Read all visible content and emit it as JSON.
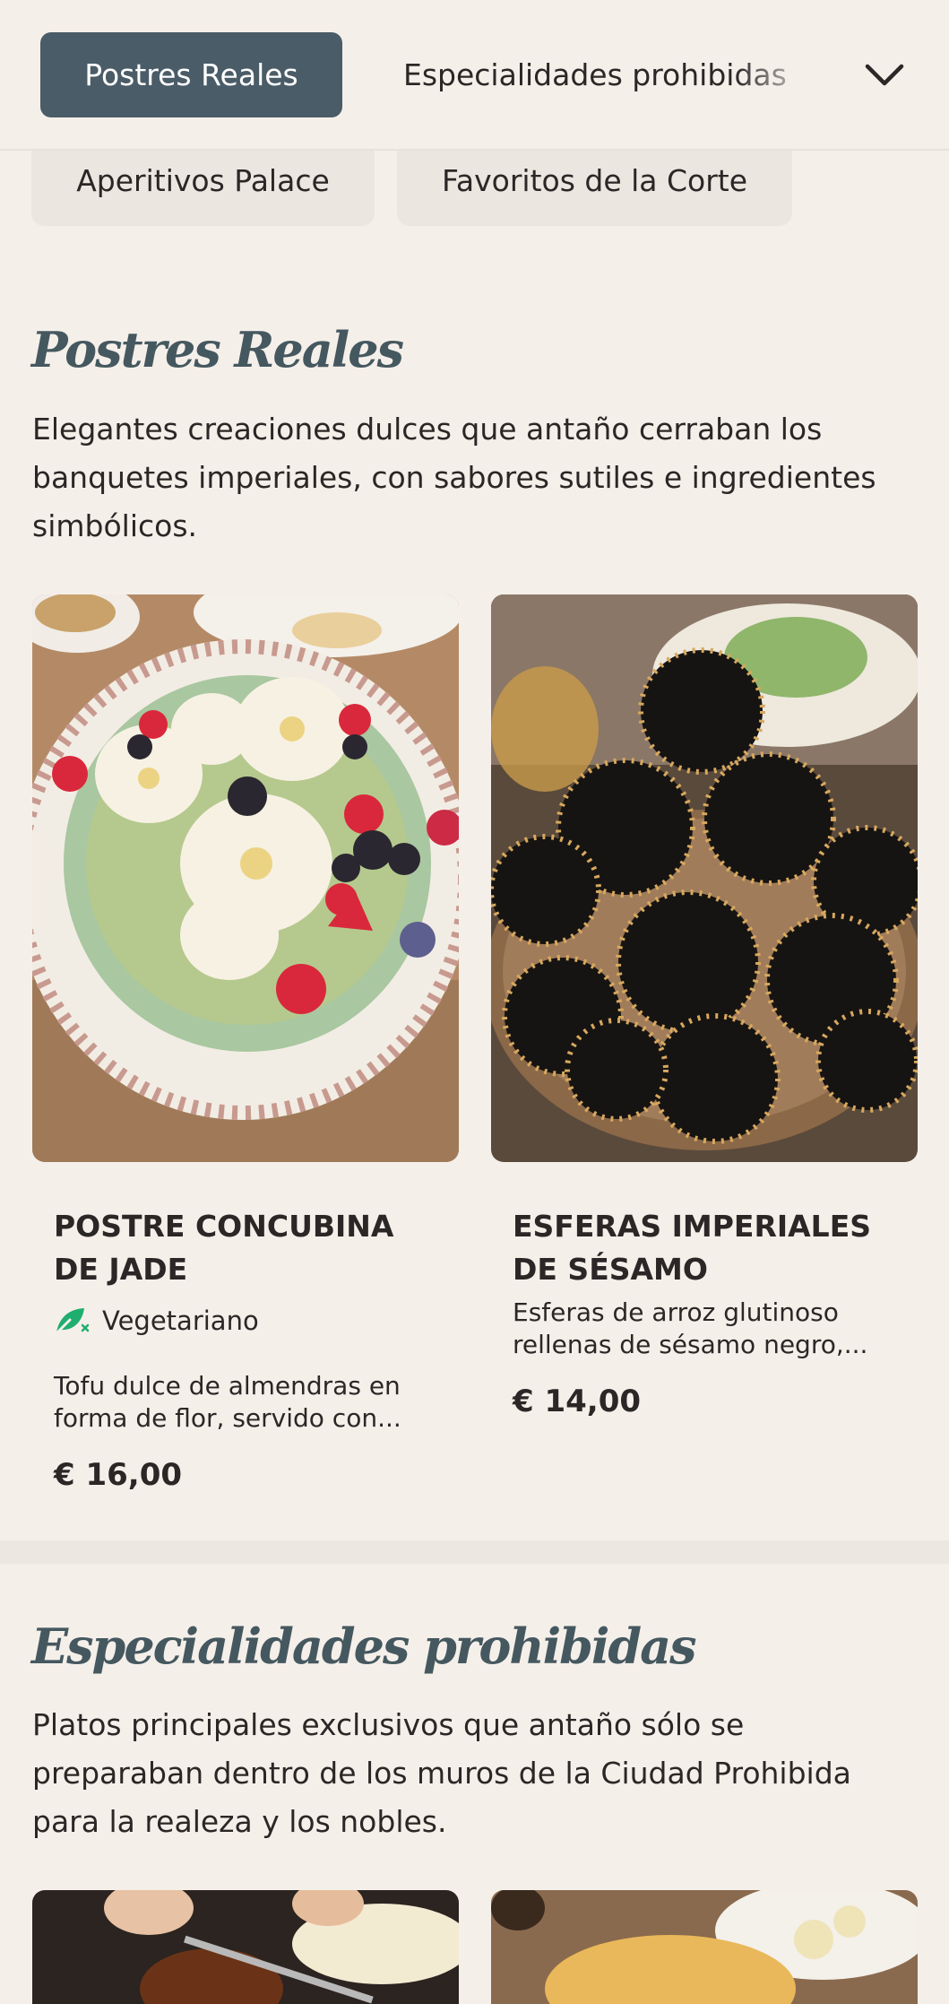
{
  "nav": {
    "tabs": [
      {
        "label": "Postres Reales",
        "active": true
      },
      {
        "label": "Especialidades prohibidas",
        "active": false
      },
      {
        "label": "Aperitivos Palace",
        "active": false
      },
      {
        "label": "Favoritos de la Corte",
        "active": false
      }
    ],
    "more_icon": "chevron-down-icon"
  },
  "sections": [
    {
      "title": "Postres Reales",
      "description": "Elegantes creaciones dulces que antaño cerraban los banquetes imperiales, con sabores sutiles e ingredientes simbólicos.",
      "items": [
        {
          "name": "POSTRE CONCUBINA DE JADE",
          "tag": "Vegetariano",
          "tag_icon": "vegetarian-leaf-icon",
          "description": "Tofu dulce de almendras en forma de flor, servido con...",
          "price": "€ 16,00",
          "image": "almond-tofu-flowers-berries-photo"
        },
        {
          "name": "ESFERAS IMPERIALES DE SÉSAMO",
          "description": "Esferas de arroz glutinoso rellenas de sésamo negro,...",
          "price": "€ 14,00",
          "image": "sesame-balls-pyramid-photo"
        }
      ]
    },
    {
      "title": "Especialidades prohibidas",
      "description": "Platos principales exclusivos que antaño sólo se preparaban dentro de los muros de la Ciudad Prohibida para la realeza y los nobles.",
      "items": [
        {
          "image": "peking-duck-carving-photo"
        },
        {
          "image": "golden-dish-photo"
        }
      ]
    }
  ],
  "colors": {
    "background": "#f5efea",
    "active_tab": "#4a5c67",
    "section_title": "#45585f",
    "vegetarian_icon": "#1fae6e"
  }
}
